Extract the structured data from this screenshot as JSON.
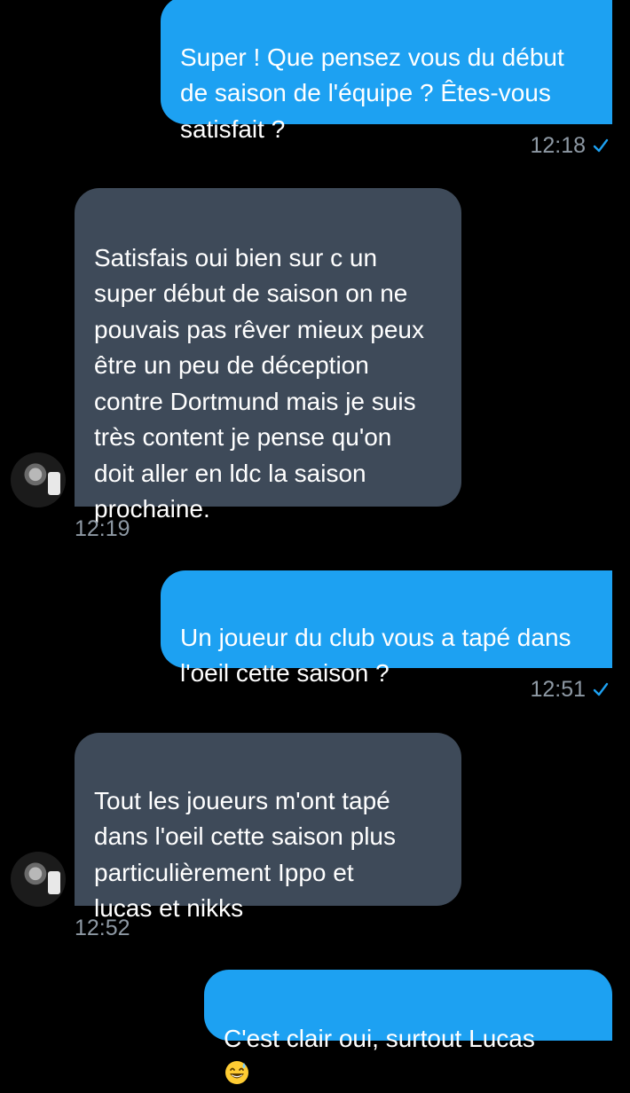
{
  "messages": [
    {
      "direction": "out",
      "text": "Super ! Que pensez vous du début\nde saison de l'équipe ? Êtes-vous\nsatisfait ?",
      "time": "12:18"
    },
    {
      "direction": "in",
      "text": "Satisfais oui bien sur c un\nsuper début de saison on ne\npouvais pas rêver mieux peux\nêtre un peu de déception\ncontre Dortmund mais je suis\ntrès content je pense qu'on\ndoit aller en ldc la saison\nprochaine.",
      "time": "12:19"
    },
    {
      "direction": "out",
      "text": "Un joueur du club vous a tapé dans\nl'oeil cette saison ?",
      "time": "12:51"
    },
    {
      "direction": "in",
      "text": "Tout les joueurs m'ont tapé\ndans l'oeil cette saison plus\nparticulièrement Ippo et\nlucas et nikks",
      "time": "12:52"
    },
    {
      "direction": "out",
      "text": "C'est clair oui, surtout Lucas",
      "emoji": "grinning-sweat-emoji"
    }
  ],
  "colors": {
    "background": "#000000",
    "outgoing_bubble": "#1da1f2",
    "incoming_bubble": "#3e4a59",
    "timestamp": "#8e99a4",
    "read_check": "#1da1f2"
  },
  "icons": {
    "read_receipt": "checkmark-icon",
    "avatar": "contact-avatar"
  }
}
